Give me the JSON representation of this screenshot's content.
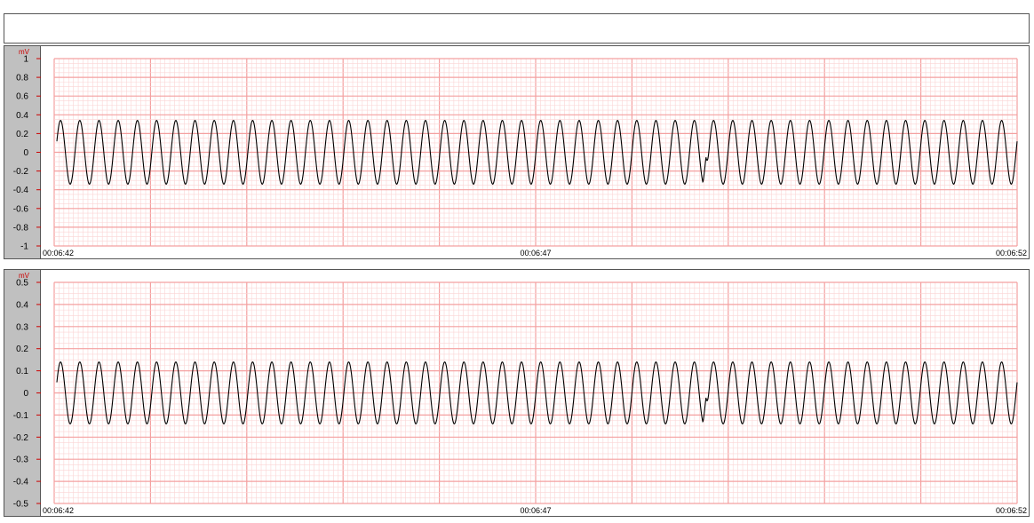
{
  "chart_data": [
    {
      "type": "line",
      "unit": "mV",
      "ylim": [
        -1,
        1
      ],
      "yticks": [
        "1",
        "0.8",
        "0.6",
        "0.4",
        "0.2",
        "0",
        "-0.2",
        "-0.4",
        "-0.6",
        "-0.8",
        "-1"
      ],
      "ytick_values": [
        1,
        0.8,
        0.6,
        0.4,
        0.2,
        0,
        -0.2,
        -0.4,
        -0.6,
        -0.8,
        -1
      ],
      "time_labels": [
        "00:06:42",
        "00:06:47",
        "00:06:52"
      ],
      "series": [
        {
          "amplitude": 0.34,
          "cycles": 50,
          "color": "#000000",
          "glitch_at_cycle": 33.8
        }
      ]
    },
    {
      "type": "line",
      "unit": "mV",
      "ylim": [
        -0.5,
        0.5
      ],
      "yticks": [
        "0.5",
        "0.4",
        "0.3",
        "0.2",
        "0.1",
        "0",
        "-0.1",
        "-0.2",
        "-0.3",
        "-0.4",
        "-0.5"
      ],
      "ytick_values": [
        0.5,
        0.4,
        0.3,
        0.2,
        0.1,
        0,
        -0.1,
        -0.2,
        -0.3,
        -0.4,
        -0.5
      ],
      "time_labels": [
        "00:06:42",
        "00:06:47",
        "00:06:52"
      ],
      "series": [
        {
          "amplitude": 0.14,
          "cycles": 50,
          "color": "#000000",
          "glitch_at_cycle": 33.8
        }
      ]
    }
  ],
  "colors": {
    "grid_major": "#f4a0a0",
    "grid_minor": "#fbd4d4",
    "axis_strip": "#c0c0c0"
  }
}
